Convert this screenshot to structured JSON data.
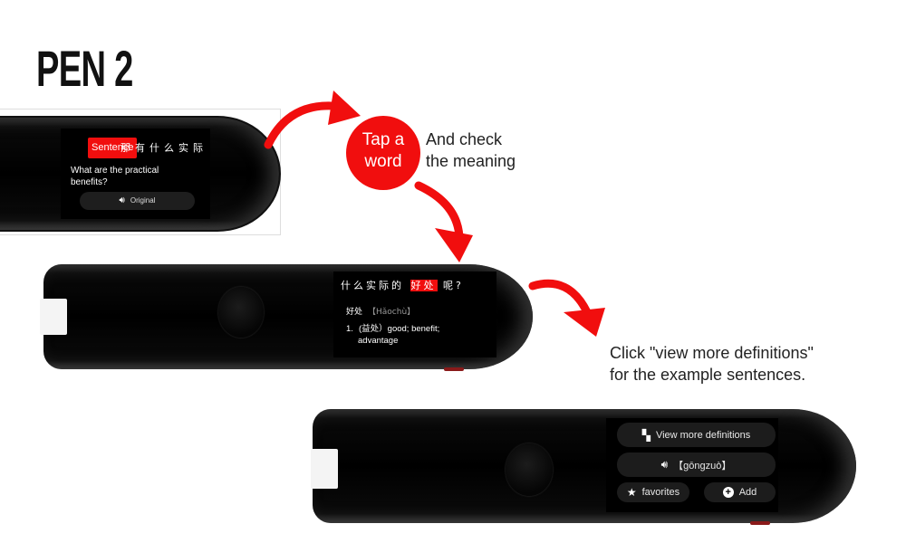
{
  "title": "PEN 2",
  "pen1": {
    "sentence_tag": "Sentence",
    "chinese": "那有什么实际",
    "english": "What are the practical benefits?",
    "original_label": "Original",
    "speaker_icon": "speaker-icon"
  },
  "step1": {
    "circle_line1": "Tap a",
    "circle_line2": "word",
    "note_line1": "And check",
    "note_line2": "the meaning"
  },
  "pen2": {
    "sentence_before": "什么实际的",
    "sentence_highlight": "好处",
    "sentence_after": "呢?",
    "word": "好处",
    "pinyin": "【Hǎochù】",
    "def_number": "1.",
    "def_line1": "(益处）good; benefit;",
    "def_line2": "advantage"
  },
  "step2": {
    "note_line1": "Click \"view more definitions\"",
    "note_line2": "for the example sentences."
  },
  "pen3": {
    "view_more_label": "View more definitions",
    "pinyin": "【gōngzuò】",
    "favorites_label": "favorites",
    "add_label": "Add",
    "grid_icon": "apps-icon",
    "speaker_icon": "speaker-icon",
    "star_icon": "star-icon",
    "plus_icon": "plus-circle-icon"
  },
  "colors": {
    "accent": "#f10e0e",
    "pen_body": "#000000",
    "pill_bg": "#1c1c1c"
  }
}
